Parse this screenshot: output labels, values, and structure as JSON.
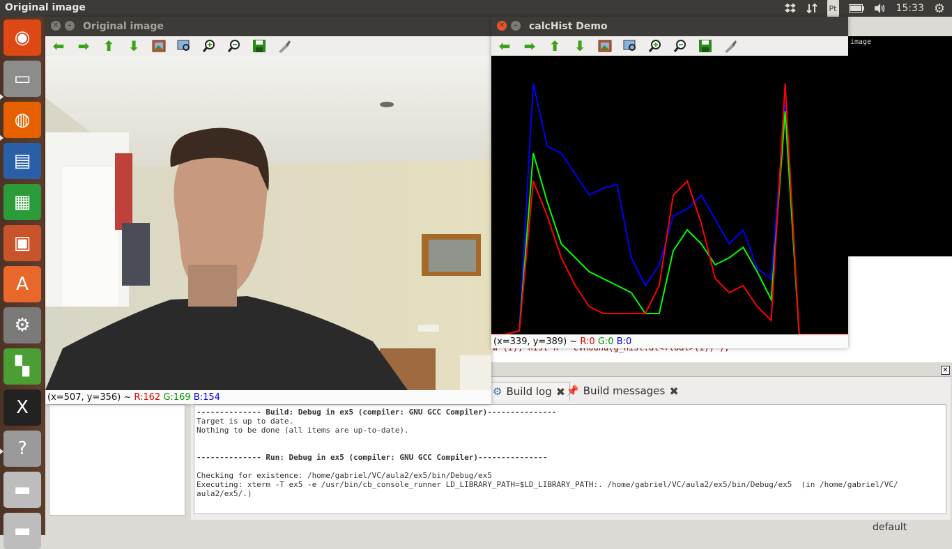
{
  "top_panel": {
    "app_title": "Original image",
    "keyboard_label": "Pt",
    "time": "15:33"
  },
  "launcher": {
    "items": [
      {
        "name": "ubuntu-dash-icon",
        "color": "#dd4814"
      },
      {
        "name": "files-icon",
        "color": "#8c8c8c"
      },
      {
        "name": "firefox-icon",
        "color": "#e66000"
      },
      {
        "name": "writer-icon",
        "color": "#2a5fa8"
      },
      {
        "name": "calc-icon",
        "color": "#2c9b3a"
      },
      {
        "name": "impress-icon",
        "color": "#c9532b"
      },
      {
        "name": "software-center-icon",
        "color": "#e8672a"
      },
      {
        "name": "settings-icon",
        "color": "#7a7a7a"
      },
      {
        "name": "codeblocks-icon",
        "color": "#4a9e33"
      },
      {
        "name": "xterm-icon",
        "color": "#222222"
      },
      {
        "name": "help-icon",
        "color": "#9a9a9a"
      },
      {
        "name": "drive-icon",
        "color": "#bdbdbd"
      },
      {
        "name": "drive2-icon",
        "color": "#bdbdbd"
      }
    ]
  },
  "original_window": {
    "title": "Original image",
    "status": {
      "coords": "(x=507, y=356) ~",
      "r": "R:162",
      "g": "G:169",
      "b": "B:154"
    }
  },
  "hist_window": {
    "title": "calcHist Demo",
    "status": {
      "coords": "(x=339, y=389) ~",
      "r": "R:0",
      "g": "G:0",
      "b": "B:0"
    }
  },
  "background_window": {
    "label": "image"
  },
  "toolbar_icons": [
    "arrow-left-icon",
    "arrow-right-icon",
    "arrow-up-icon",
    "arrow-down-icon",
    "fit-image-icon",
    "zoom-region-icon",
    "zoom-in-icon",
    "zoom-out-icon",
    "save-icon",
    "properties-icon"
  ],
  "codeblocks": {
    "code_line": "w-(i), hist-h - cvRound(g_hist.at<float>(i)) ),",
    "tabs": [
      {
        "label": "Build log"
      },
      {
        "label": "Build messages"
      }
    ],
    "log": {
      "line1": "-------------- Build: Debug in ex5 (compiler: GNU GCC Compiler)---------------",
      "line2": "Target is up to date.",
      "line3": "Nothing to be done (all items are up-to-date).",
      "line4": "-------------- Run: Debug in ex5 (compiler: GNU GCC Compiler)---------------",
      "line5": "Checking for existence: /home/gabriel/VC/aula2/ex5/bin/Debug/ex5",
      "line6": "Executing: xterm -T ex5 -e /usr/bin/cb_console_runner LD_LIBRARY_PATH=$LD_LIBRARY_PATH:. /home/gabriel/VC/aula2/ex5/bin/Debug/ex5  (in /home/gabriel/VC/",
      "line7": "aula2/ex5/.)"
    },
    "status_right": "default"
  },
  "colors": {
    "red": "#ff0000",
    "green": "#00ff00",
    "blue": "#0000ff"
  },
  "chart_data": {
    "type": "line",
    "x": [
      0,
      10,
      20,
      30,
      40,
      50,
      60,
      70,
      80,
      90,
      100,
      110,
      120,
      130,
      140,
      150,
      160,
      170,
      180,
      190,
      200,
      210,
      220,
      230,
      240,
      250,
      255
    ],
    "series": [
      {
        "color": "#0000ff",
        "values": [
          0,
          0,
          5,
          360,
          270,
          260,
          230,
          200,
          210,
          215,
          110,
          70,
          100,
          170,
          180,
          200,
          165,
          130,
          150,
          95,
          80,
          330,
          0,
          0,
          0,
          0,
          0
        ]
      },
      {
        "color": "#00ff00",
        "values": [
          0,
          0,
          5,
          260,
          190,
          130,
          110,
          90,
          80,
          70,
          60,
          30,
          30,
          120,
          150,
          130,
          100,
          110,
          125,
          90,
          50,
          320,
          0,
          0,
          0,
          0,
          0
        ]
      },
      {
        "color": "#ff0000",
        "values": [
          0,
          0,
          5,
          220,
          170,
          110,
          70,
          40,
          30,
          30,
          30,
          30,
          70,
          200,
          220,
          160,
          80,
          60,
          70,
          40,
          20,
          360,
          0,
          0,
          0,
          0,
          0
        ]
      }
    ],
    "xlim": [
      0,
      255
    ],
    "ylim": [
      0,
      400
    ]
  }
}
